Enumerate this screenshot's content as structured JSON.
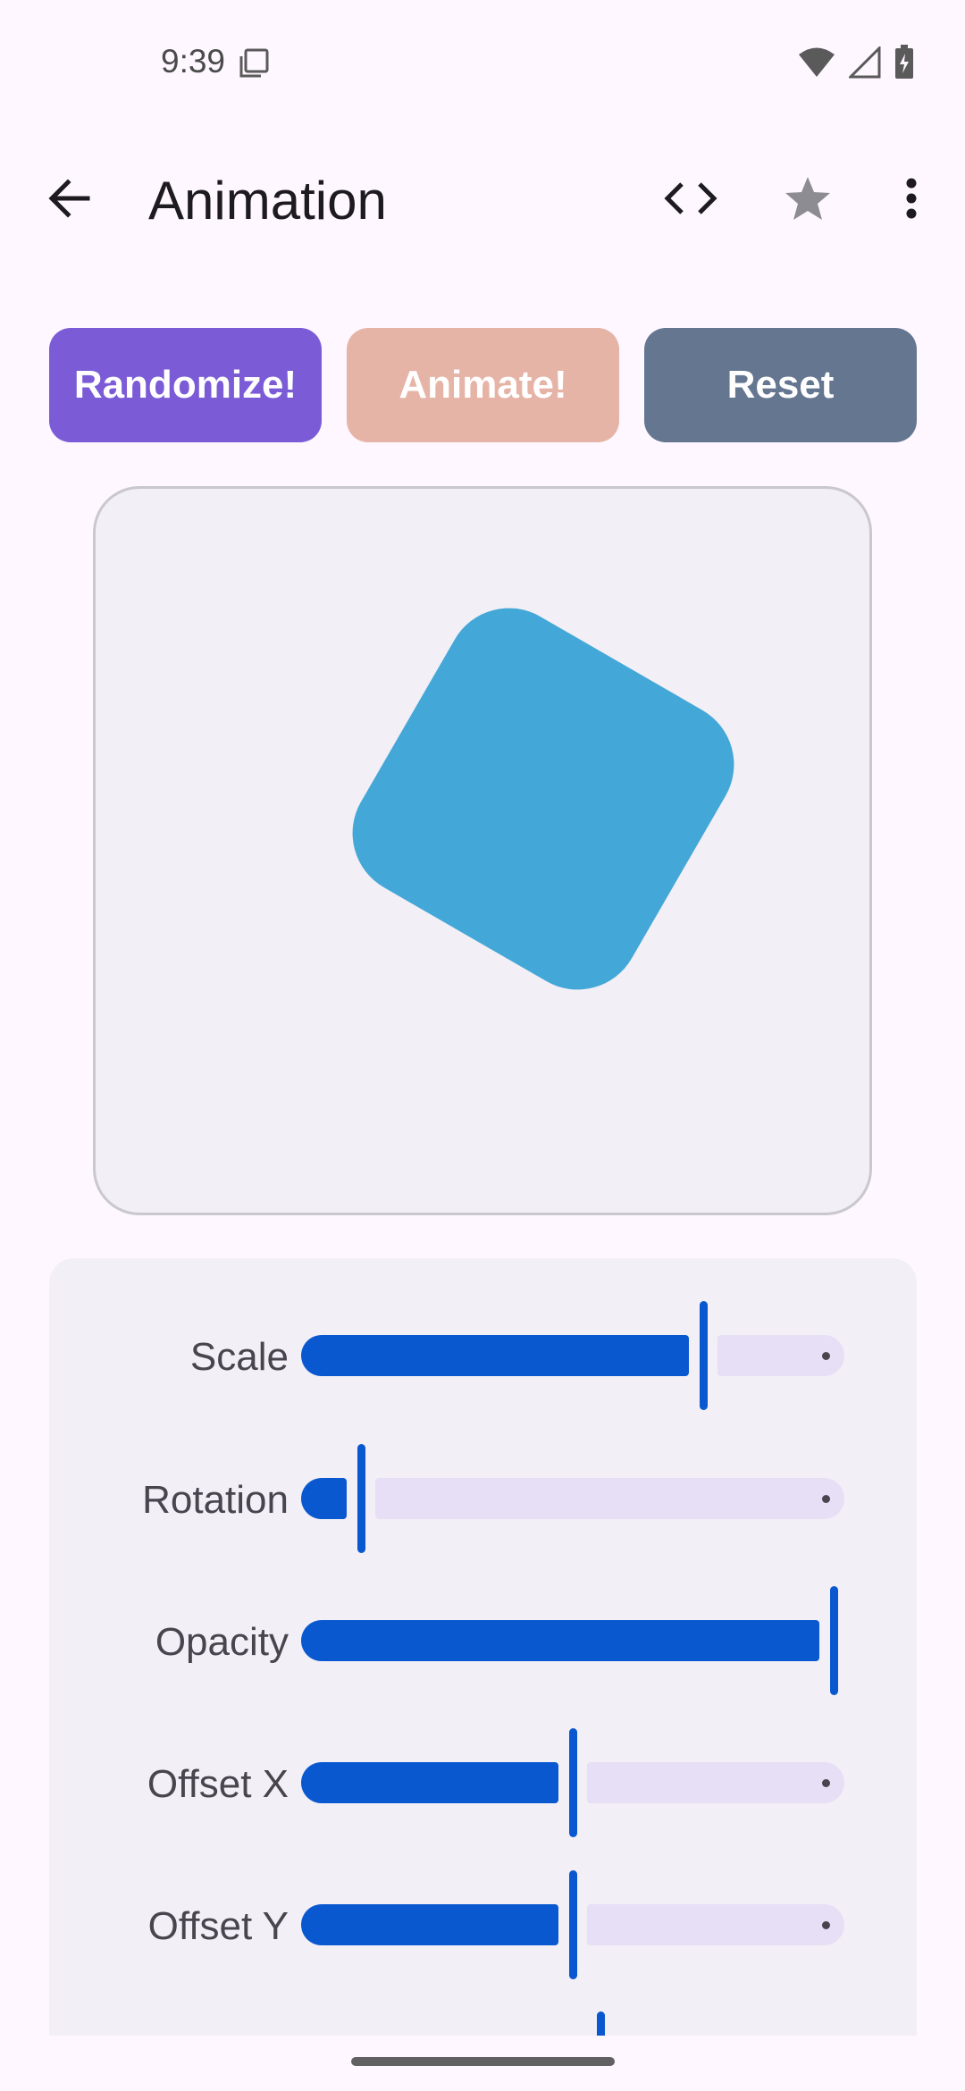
{
  "status_bar": {
    "time": "9:39"
  },
  "app_bar": {
    "title": "Animation"
  },
  "buttons": {
    "randomize": "Randomize!",
    "animate": "Animate!",
    "reset": "Reset"
  },
  "colors": {
    "randomize": "#7B5CD6",
    "animate": "#E6B4A7",
    "reset": "#647690",
    "shape": "#43A7D7",
    "slider_active": "#0A58D0",
    "slider_inactive": "#E6DFF5"
  },
  "sliders": [
    {
      "label": "Scale",
      "value": 0.74
    },
    {
      "label": "Rotation",
      "value": 0.11
    },
    {
      "label": "Opacity",
      "value": 0.98
    },
    {
      "label": "Offset X",
      "value": 0.5
    },
    {
      "label": "Offset Y",
      "value": 0.5
    }
  ],
  "icons": {
    "back": "arrow-back-icon",
    "code": "code-icon",
    "favorite": "star-icon",
    "more": "more-vert-icon"
  }
}
